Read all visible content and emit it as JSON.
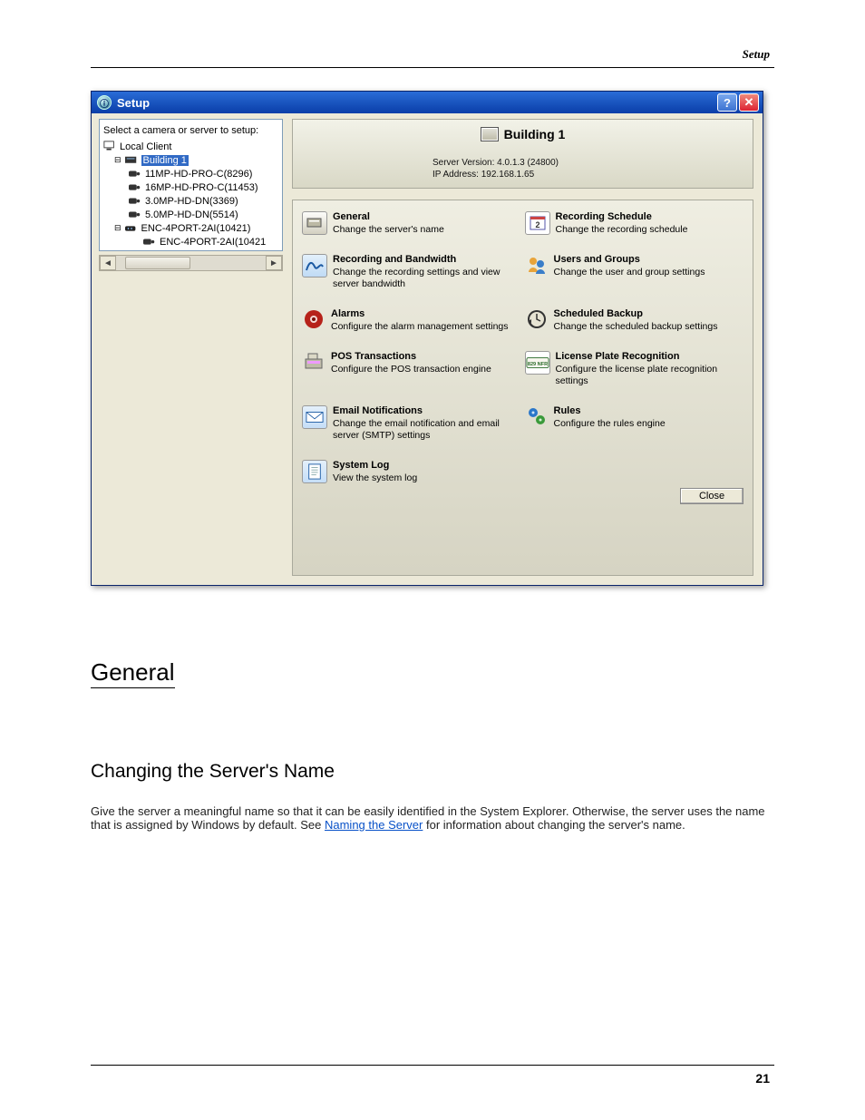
{
  "page": {
    "header_label": "Setup",
    "number": "21",
    "section_title": "General",
    "subsection_title": "Changing the Server's Name",
    "body_text_before_link": "Give the server a meaningful name so that it can be easily identified in the System Explorer. Otherwise, the server uses the name that is assigned by Windows by default. See ",
    "link_text": "Naming the Server",
    "body_text_after_link": " for information about changing the server's name."
  },
  "dialog": {
    "title": "Setup",
    "help_hint": "?",
    "close_hint": "✕",
    "tree": {
      "caption": "Select a camera or server to setup:",
      "items": [
        {
          "label": "Local Client",
          "type": "client"
        },
        {
          "label": "Building 1",
          "type": "server-selected"
        },
        {
          "label": "11MP-HD-PRO-C(8296)",
          "type": "camera"
        },
        {
          "label": "16MP-HD-PRO-C(11453)",
          "type": "camera"
        },
        {
          "label": "3.0MP-HD-DN(3369)",
          "type": "camera"
        },
        {
          "label": "5.0MP-HD-DN(5514)",
          "type": "camera"
        },
        {
          "label": "ENC-4PORT-2AI(10421)",
          "type": "encoder"
        },
        {
          "label": "ENC-4PORT-2AI(10421",
          "type": "camera-under-enc"
        }
      ]
    },
    "header": {
      "server_name": "Building 1",
      "server_version_label": "Server Version: 4.0.1.3 (24800)",
      "ip_label": "IP Address: 192.168.1.65"
    },
    "options": [
      {
        "icon": "general",
        "title": "General",
        "desc": "Change the server's name"
      },
      {
        "icon": "schedule",
        "title": "Recording Schedule",
        "desc": "Change the recording schedule"
      },
      {
        "icon": "bandwidth",
        "title": "Recording and Bandwidth",
        "desc": "Change the recording settings and view server bandwidth"
      },
      {
        "icon": "users",
        "title": "Users and Groups",
        "desc": "Change the user and group settings"
      },
      {
        "icon": "alarms",
        "title": "Alarms",
        "desc": "Configure the alarm management settings"
      },
      {
        "icon": "backup",
        "title": "Scheduled Backup",
        "desc": "Change the scheduled backup settings"
      },
      {
        "icon": "pos",
        "title": "POS Transactions",
        "desc": "Configure the POS transaction engine"
      },
      {
        "icon": "lpr",
        "title": "License Plate Recognition",
        "desc": "Configure the license plate recognition settings"
      },
      {
        "icon": "email",
        "title": "Email Notifications",
        "desc": "Change the email notification and email server (SMTP) settings"
      },
      {
        "icon": "rules",
        "title": "Rules",
        "desc": "Configure the rules engine"
      },
      {
        "icon": "log",
        "title": "System Log",
        "desc": "View the system log"
      }
    ],
    "close_button": "Close"
  }
}
